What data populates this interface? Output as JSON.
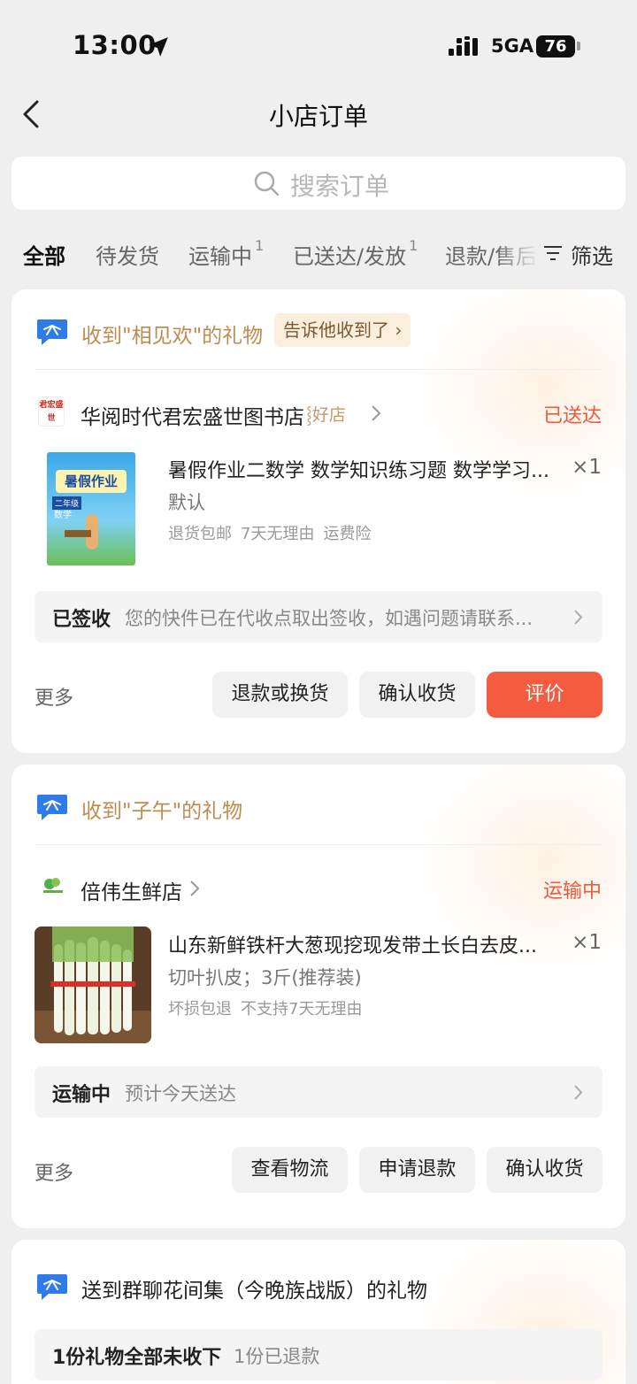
{
  "status_bar": {
    "time": "13:00",
    "network": "5GA",
    "battery": "76"
  },
  "nav": {
    "title": "小店订单"
  },
  "search": {
    "placeholder": "搜索订单"
  },
  "tabs": [
    {
      "label": "全部",
      "badge": ""
    },
    {
      "label": "待发货",
      "badge": ""
    },
    {
      "label": "运输中",
      "badge": "1"
    },
    {
      "label": "已送达/发放",
      "badge": "1"
    },
    {
      "label": "退款/售后",
      "badge": ""
    }
  ],
  "filter": {
    "label": "筛选"
  },
  "orders": [
    {
      "gift_text": "收到\"相见欢\"的礼物",
      "gift_action": "告诉他收到了",
      "shop": {
        "name": "华阅时代君宏盛世图书店",
        "badge": "好店",
        "avatar_text": "君宏盛世"
      },
      "status": "已送达",
      "product": {
        "title": "暑假作业二数学 数学知识练习题 数学学习...",
        "quantity": "×1",
        "spec": "默认",
        "services": [
          "退货包邮",
          "7天无理由",
          "运费险"
        ],
        "image_texts": [
          "暑假作业",
          "二年级",
          "数学"
        ]
      },
      "logistics": {
        "status": "已签收",
        "text": "您的快件已在代收点取出签收，如遇问题请联系..."
      },
      "more": "更多",
      "buttons": [
        "退款或换货",
        "确认收货",
        "评价"
      ]
    },
    {
      "gift_text": "收到\"子午\"的礼物",
      "shop": {
        "name": "倍伟生鲜店"
      },
      "status": "运输中",
      "product": {
        "title": "山东新鲜铁杆大葱现挖现发带土长白去皮...",
        "quantity": "×1",
        "spec": "切叶扒皮；3斤(推荐装)",
        "services": [
          "坏损包退",
          "不支持7天无理由"
        ]
      },
      "logistics": {
        "status": "运输中",
        "text": "预计今天送达"
      },
      "more": "更多",
      "buttons": [
        "查看物流",
        "申请退款",
        "确认收货"
      ]
    },
    {
      "gift_text": "送到群聊花间集（今晚族战版）的礼物",
      "summary": {
        "status": "1份礼物全部未收下",
        "text": "1份已退款"
      }
    }
  ],
  "colors": {
    "accent": "#f55b3f",
    "gift": "#c08b4f",
    "icon_blue": "#2f7be8"
  }
}
